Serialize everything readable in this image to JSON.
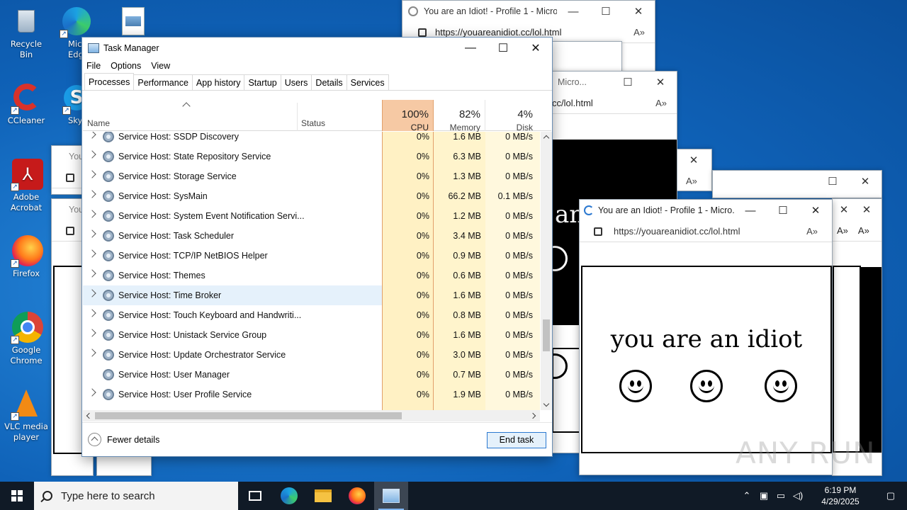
{
  "desktop": {
    "icons": [
      {
        "label": "Recycle Bin"
      },
      {
        "label": "Micro Edg"
      },
      {
        "label": "CCleaner"
      },
      {
        "label": "Sky"
      },
      {
        "label": "Adobe Acrobat"
      },
      {
        "label": "Firefox"
      },
      {
        "label": "Google Chrome"
      },
      {
        "label": "VLC media player"
      }
    ]
  },
  "background_windows": {
    "top_title": "You are an Idiot! - Profile 1 - Micro...",
    "top_url": "https://youareanidiot.cc/lol.html",
    "mid_title": "Micro...",
    "mid_url": "cc/lol.html",
    "left_title_1": "You",
    "left_title_2": "You",
    "partial_text": "an"
  },
  "idiot_window": {
    "title": "You are an Idiot! - Profile 1 - Micro...",
    "url": "https://youareanidiot.cc/lol.html",
    "message": "you are an idiot"
  },
  "task_manager": {
    "title": "Task Manager",
    "menu": [
      "File",
      "Options",
      "View"
    ],
    "tabs": [
      "Processes",
      "Performance",
      "App history",
      "Startup",
      "Users",
      "Details",
      "Services"
    ],
    "columns": {
      "name": "Name",
      "status": "Status",
      "cpu_pct": "100%",
      "cpu": "CPU",
      "mem_pct": "82%",
      "mem": "Memory",
      "disk_pct": "4%",
      "disk": "Disk"
    },
    "rows": [
      {
        "name": "Service Host: SSDP Discovery",
        "cpu": "0%",
        "mem": "1.6 MB",
        "disk": "0 MB/s"
      },
      {
        "name": "Service Host: State Repository Service",
        "cpu": "0%",
        "mem": "6.3 MB",
        "disk": "0 MB/s"
      },
      {
        "name": "Service Host: Storage Service",
        "cpu": "0%",
        "mem": "1.3 MB",
        "disk": "0 MB/s"
      },
      {
        "name": "Service Host: SysMain",
        "cpu": "0%",
        "mem": "66.2 MB",
        "disk": "0.1 MB/s"
      },
      {
        "name": "Service Host: System Event Notification Servi...",
        "cpu": "0%",
        "mem": "1.2 MB",
        "disk": "0 MB/s"
      },
      {
        "name": "Service Host: Task Scheduler",
        "cpu": "0%",
        "mem": "3.4 MB",
        "disk": "0 MB/s"
      },
      {
        "name": "Service Host: TCP/IP NetBIOS Helper",
        "cpu": "0%",
        "mem": "0.9 MB",
        "disk": "0 MB/s"
      },
      {
        "name": "Service Host: Themes",
        "cpu": "0%",
        "mem": "0.6 MB",
        "disk": "0 MB/s"
      },
      {
        "name": "Service Host: Time Broker",
        "cpu": "0%",
        "mem": "1.6 MB",
        "disk": "0 MB/s"
      },
      {
        "name": "Service Host: Touch Keyboard and Handwriti...",
        "cpu": "0%",
        "mem": "0.8 MB",
        "disk": "0 MB/s"
      },
      {
        "name": "Service Host: Unistack Service Group",
        "cpu": "0%",
        "mem": "1.6 MB",
        "disk": "0 MB/s"
      },
      {
        "name": "Service Host: Update Orchestrator Service",
        "cpu": "0%",
        "mem": "3.0 MB",
        "disk": "0 MB/s"
      },
      {
        "name": "Service Host: User Manager",
        "cpu": "0%",
        "mem": "0.7 MB",
        "disk": "0 MB/s"
      },
      {
        "name": "Service Host: User Profile Service",
        "cpu": "0%",
        "mem": "1.9 MB",
        "disk": "0 MB/s"
      }
    ],
    "fewer_details": "Fewer details",
    "end_task": "End task"
  },
  "taskbar": {
    "search_placeholder": "Type here to search",
    "time": "6:19 PM",
    "date": "4/29/2025"
  },
  "watermark": "ANY RUN",
  "colors": {
    "cpu_header": "#f6c9a4",
    "cpu_col": "#fff1c4",
    "mem_col": "#fff4cc",
    "selected_row": "#e5f1fb",
    "accent": "#2b78d0"
  }
}
